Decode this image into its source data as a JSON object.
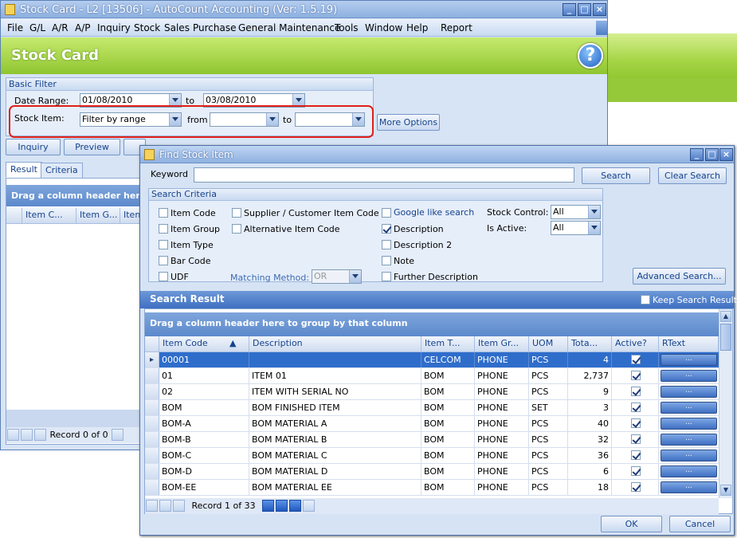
{
  "main_window": {
    "title": "Stock Card - L2 [13506] - AutoCount Accounting (Ver: 1.5.19)",
    "menu": [
      "File",
      "G/L",
      "A/R",
      "A/P",
      "Inquiry",
      "Stock",
      "Sales",
      "Purchase",
      "General Maintenance",
      "Tools",
      "Window",
      "Help",
      "Report"
    ],
    "banner_title": "Stock Card",
    "help_glyph": "?",
    "basic_filter": {
      "header": "Basic Filter",
      "date_range_label": "Date Range:",
      "date_from": "01/08/2010",
      "to_label": "to",
      "date_to": "03/08/2010",
      "stock_item_label": "Stock Item:",
      "stock_item_value": "Filter by range",
      "from_label": "from",
      "from_value": "",
      "to_label2": "to",
      "to_value": ""
    },
    "more_options_label": "More Options",
    "action_buttons": [
      "Inquiry",
      "Preview"
    ],
    "tabs": [
      "Result",
      "Criteria"
    ],
    "group_hint": "Drag a column header here to",
    "columns": [
      "Item C...",
      "Item G...",
      "Item"
    ],
    "record_text": "Record 0 of 0"
  },
  "find_dialog": {
    "title": "Find Stock Item",
    "keyword_label": "Keyword",
    "keyword_value": "",
    "search_label": "Search",
    "clear_search_label": "Clear Search",
    "criteria_header": "Search Criteria",
    "criteria_col1": [
      {
        "label": "Item Code",
        "checked": false
      },
      {
        "label": "Item Group",
        "checked": false
      },
      {
        "label": "Item Type",
        "checked": false
      },
      {
        "label": "Bar Code",
        "checked": false
      },
      {
        "label": "UDF",
        "checked": false
      }
    ],
    "criteria_col2": [
      {
        "label": "Supplier / Customer Item Code",
        "checked": false
      },
      {
        "label": "Alternative Item Code",
        "checked": false
      }
    ],
    "matching_method_label": "Matching Method:",
    "matching_method_value": "OR",
    "criteria_col3": [
      {
        "label": "Google like search",
        "checked": false
      },
      {
        "label": "Description",
        "checked": true
      },
      {
        "label": "Description 2",
        "checked": false
      },
      {
        "label": "Note",
        "checked": false
      },
      {
        "label": "Further Description",
        "checked": false
      }
    ],
    "stock_control_label": "Stock Control:",
    "stock_control_value": "All",
    "is_active_label": "Is Active:",
    "is_active_value": "All",
    "advanced_search_label": "Advanced Search...",
    "result_header": "Search Result",
    "keep_search_label": "Keep Search Result",
    "group_hint": "Drag a column header here to group by that column",
    "columns": [
      "Item Code",
      "Description",
      "Item T...",
      "Item Gr...",
      "UOM",
      "Tota...",
      "Active?",
      "RText"
    ],
    "rows": [
      {
        "code": "00001",
        "desc": "",
        "type": "CELCOM",
        "group": "PHONE",
        "uom": "PCS",
        "total": "4",
        "active": true,
        "rtext": "..."
      },
      {
        "code": "01",
        "desc": "ITEM 01",
        "type": "BOM",
        "group": "PHONE",
        "uom": "PCS",
        "total": "2,737",
        "active": true,
        "rtext": "..."
      },
      {
        "code": "02",
        "desc": "ITEM WITH SERIAL NO",
        "type": "BOM",
        "group": "PHONE",
        "uom": "PCS",
        "total": "9",
        "active": true,
        "rtext": "..."
      },
      {
        "code": "BOM",
        "desc": "BOM FINISHED ITEM",
        "type": "BOM",
        "group": "PHONE",
        "uom": "SET",
        "total": "3",
        "active": true,
        "rtext": "..."
      },
      {
        "code": "BOM-A",
        "desc": "BOM MATERIAL A",
        "type": "BOM",
        "group": "PHONE",
        "uom": "PCS",
        "total": "40",
        "active": true,
        "rtext": "..."
      },
      {
        "code": "BOM-B",
        "desc": "BOM MATERIAL B",
        "type": "BOM",
        "group": "PHONE",
        "uom": "PCS",
        "total": "32",
        "active": true,
        "rtext": "..."
      },
      {
        "code": "BOM-C",
        "desc": "BOM MATERIAL C",
        "type": "BOM",
        "group": "PHONE",
        "uom": "PCS",
        "total": "36",
        "active": true,
        "rtext": "..."
      },
      {
        "code": "BOM-D",
        "desc": "BOM MATERIAL D",
        "type": "BOM",
        "group": "PHONE",
        "uom": "PCS",
        "total": "6",
        "active": true,
        "rtext": "..."
      },
      {
        "code": "BOM-EE",
        "desc": "BOM MATERIAL EE",
        "type": "BOM",
        "group": "PHONE",
        "uom": "PCS",
        "total": "18",
        "active": true,
        "rtext": "..."
      }
    ],
    "record_text": "Record 1 of 33",
    "ok_label": "OK",
    "cancel_label": "Cancel"
  },
  "colors": {
    "accent_green": "#8fc530",
    "title_blue": "#8db0e0",
    "selection": "#2f6dcb",
    "highlight_red": "#e0201a"
  }
}
